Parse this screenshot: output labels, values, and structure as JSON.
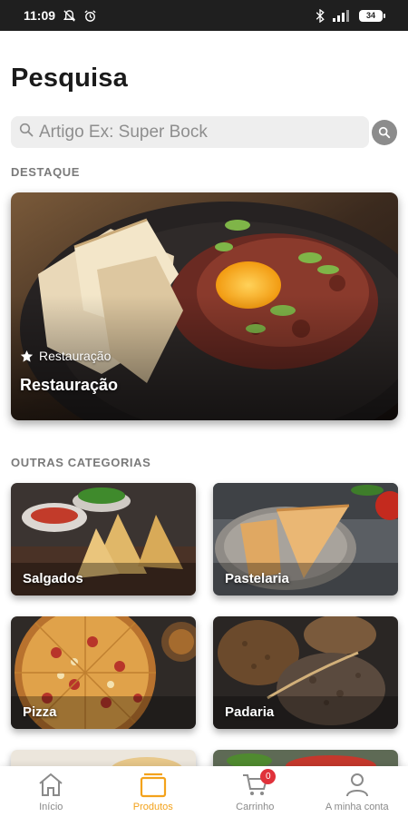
{
  "status_bar": {
    "time": "11:09",
    "battery": "34",
    "icons": [
      "mute-icon",
      "alarm-icon",
      "bluetooth-icon",
      "signal-icon",
      "battery-icon"
    ]
  },
  "header": {
    "title": "Pesquisa"
  },
  "search": {
    "placeholder": "Artigo Ex: Super Bock",
    "value": ""
  },
  "featured": {
    "section_label": "DESTAQUE",
    "tag_label": "Restauração",
    "title": "Restauração"
  },
  "categories": {
    "section_label": "OUTRAS CATEGORIAS",
    "items": [
      {
        "label": "Salgados"
      },
      {
        "label": "Pastelaria"
      },
      {
        "label": "Pizza"
      },
      {
        "label": "Padaria"
      }
    ]
  },
  "tabbar": {
    "items": [
      {
        "label": "Início",
        "icon": "home-icon"
      },
      {
        "label": "Produtos",
        "icon": "products-icon",
        "active": true
      },
      {
        "label": "Carrinho",
        "icon": "cart-icon",
        "badge": "0"
      },
      {
        "label": "A minha conta",
        "icon": "user-icon"
      }
    ]
  },
  "colors": {
    "accent": "#f3a21b",
    "badge": "#e0323b",
    "status_bar": "#1f1f1f"
  }
}
